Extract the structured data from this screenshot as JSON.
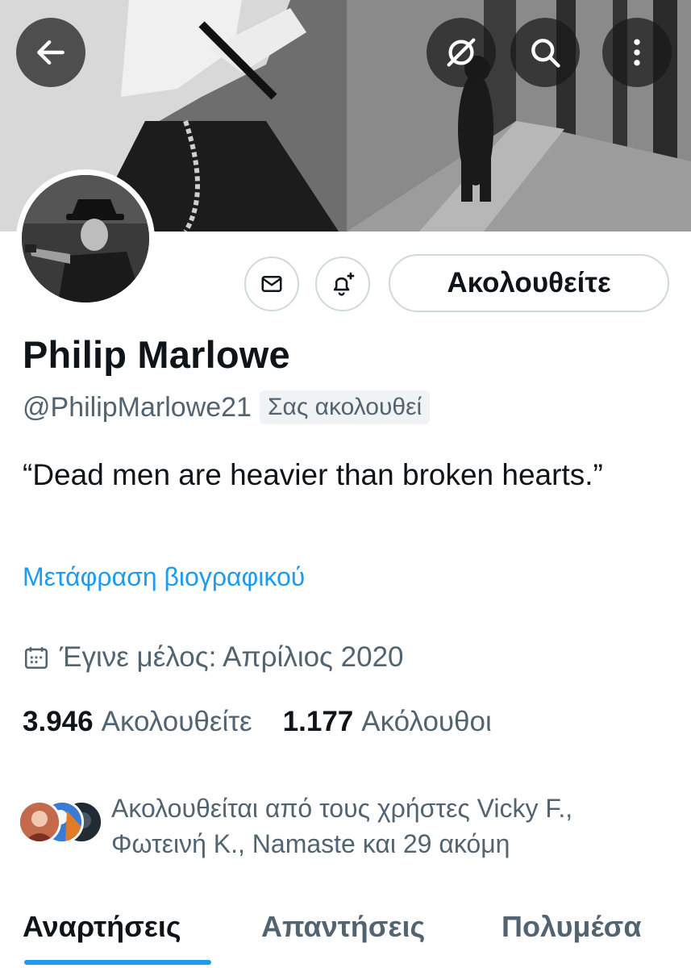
{
  "header": {
    "back_icon": "arrow-left-icon",
    "grok_icon": "grok-icon",
    "search_icon": "search-icon",
    "more_icon": "more-vertical-icon"
  },
  "profile": {
    "name": "Philip Marlowe",
    "handle": "@PhilipMarlowe21",
    "follows_you_badge": "Σας ακολουθεί",
    "bio": "“Dead men are heavier than broken hearts.”",
    "translate_bio": "Μετάφραση βιογραφικού",
    "joined": "Έγινε μέλος: Απρίλιος 2020"
  },
  "actions": {
    "message_icon": "envelope-icon",
    "notify_icon": "bell-plus-icon",
    "follow_label": "Ακολουθείτε"
  },
  "stats": {
    "following_count": "3.946",
    "following_label": "Ακολουθείτε",
    "followers_count": "1.177",
    "followers_label": "Ακόλουθοι"
  },
  "followed_by": {
    "text": "Ακολουθείται από τους χρήστες Vicky F., Φωτεινή Κ., Namaste και 29 ακόμη"
  },
  "tabs": [
    {
      "label": "Αναρτήσεις",
      "active": true
    },
    {
      "label": "Απαντήσεις",
      "active": false
    },
    {
      "label": "Πολυμέσα",
      "active": false
    }
  ],
  "colors": {
    "accent": "#1d9bf0",
    "text_primary": "#0f1419",
    "text_secondary": "#536471",
    "border": "#cfd9de"
  }
}
